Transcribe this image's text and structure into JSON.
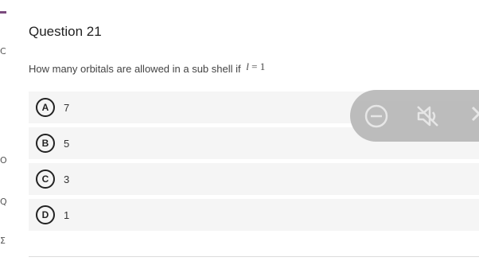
{
  "question": {
    "title": "Question 21",
    "prompt": "How many orbitals are allowed in a sub shell if",
    "formula_var": "l",
    "formula_rest": " = 1"
  },
  "options": [
    {
      "letter": "A",
      "text": "7"
    },
    {
      "letter": "B",
      "text": "5"
    },
    {
      "letter": "C",
      "text": "3"
    },
    {
      "letter": "D",
      "text": "1"
    }
  ],
  "edge_fragments": [
    "C",
    "O",
    "Q",
    "Σ"
  ],
  "overlay": {
    "icons": [
      "minus-circle-icon",
      "mute-icon",
      "close-icon"
    ],
    "color": "#b9b9b9"
  }
}
